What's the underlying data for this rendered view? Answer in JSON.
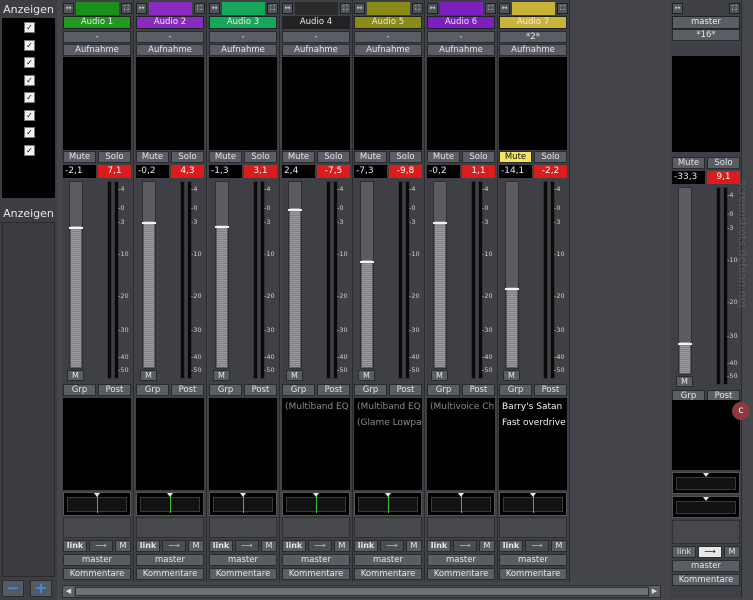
{
  "sidebar": {
    "show_title": "Anzeigen",
    "hide_title": "Anzeigen",
    "checks": [
      "✓",
      "✓",
      "✓",
      "✓",
      "✓",
      "✓",
      "✓",
      "✓"
    ],
    "minus_label": "−",
    "plus_label": "+"
  },
  "common": {
    "input": "-",
    "record": "Aufnahme",
    "mute": "Mute",
    "solo": "Solo",
    "m": "M",
    "grp": "Grp",
    "post": "Post",
    "link": "link",
    "route_arrow": "⟶",
    "output": "master",
    "comments": "Kommentare"
  },
  "scale_ticks": [
    "4",
    "0",
    "3",
    "10",
    "20",
    "30",
    "40",
    "50"
  ],
  "strips": [
    {
      "name": "Audio 1",
      "color": "#1f9a1f",
      "bar": "#1a8f1a",
      "input": "-",
      "gain": "-2,1",
      "peak": "7,1",
      "fader": 0.76,
      "mute_on": false,
      "plugins": []
    },
    {
      "name": "Audio 2",
      "color": "#8a2bc0",
      "bar": "#8a2bc0",
      "input": "-",
      "gain": "-0,2",
      "peak": "4,3",
      "fader": 0.79,
      "mute_on": false,
      "plugins": []
    },
    {
      "name": "Audio 3",
      "color": "#16a85a",
      "bar": "#16a85a",
      "input": "-",
      "gain": "-1,3",
      "peak": "3,1",
      "fader": 0.77,
      "mute_on": false,
      "plugins": []
    },
    {
      "name": "Audio 4",
      "color": "#222222",
      "bar": "#2a2a2a",
      "input": "-",
      "gain": "2,4",
      "peak": "-7,5",
      "fader": 0.86,
      "mute_on": false,
      "plugins": [
        {
          "t": "(Multiband EQ",
          "on": false
        }
      ]
    },
    {
      "name": "Audio 5",
      "color": "#8a8a16",
      "bar": "#8a8a16",
      "input": "-",
      "gain": "-7,3",
      "peak": "-9,8",
      "fader": 0.58,
      "mute_on": false,
      "plugins": [
        {
          "t": "(Multiband EQ",
          "on": false
        },
        {
          "t": "(Glame Lowpass",
          "on": false
        }
      ]
    },
    {
      "name": "Audio 6",
      "color": "#7b1fc0",
      "bar": "#7b1fc0",
      "input": "-",
      "gain": "-0,2",
      "peak": "1,1",
      "fader": 0.79,
      "mute_on": false,
      "plugins": [
        {
          "t": "(Multivoice Ch",
          "on": false
        }
      ]
    },
    {
      "name": "Audio 7",
      "color": "#c9b43a",
      "bar": "#c9b43a",
      "input": "*2*",
      "gain": "-14,1",
      "peak": "-2,2",
      "fader": 0.43,
      "mute_on": true,
      "plugins": [
        {
          "t": "Barry's Satan",
          "on": true
        },
        {
          "t": "Fast overdrive",
          "on": true
        }
      ]
    }
  ],
  "master": {
    "name": "master",
    "input": "*16*",
    "gain": "-33,3",
    "peak": "9,1",
    "fader": 0.17,
    "output": "master",
    "comments": "Kommentare"
  },
  "scroll": {
    "left": "◀",
    "right": "▶"
  },
  "watermark": "screenshots.debian.net"
}
